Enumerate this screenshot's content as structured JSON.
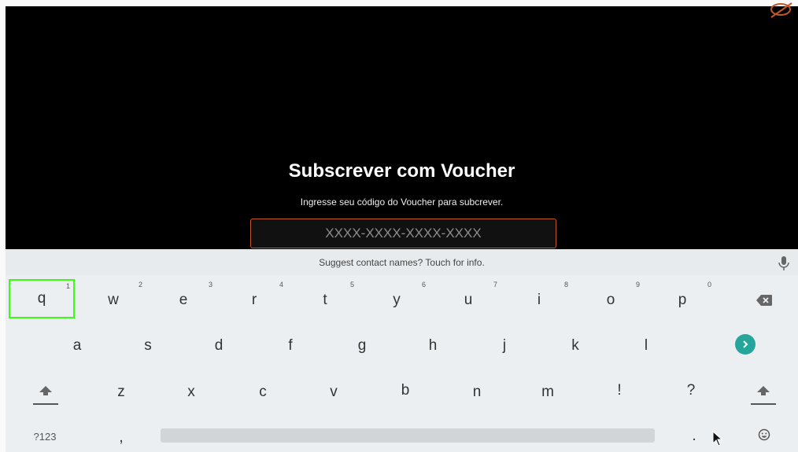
{
  "screen": {
    "title": "Subscrever com Voucher",
    "subtitle": "Ingresse seu código do Voucher para subcrever.",
    "voucher_placeholder": "XXXX-XXXX-XXXX-XXXX",
    "accent_color": "#c0582a"
  },
  "keyboard": {
    "suggest_text": "Suggest contact names? Touch for info.",
    "row1": [
      "q",
      "w",
      "e",
      "r",
      "t",
      "y",
      "u",
      "i",
      "o",
      "p"
    ],
    "row1_hints": [
      "1",
      "2",
      "3",
      "4",
      "5",
      "6",
      "7",
      "8",
      "9",
      "0"
    ],
    "row2": [
      "a",
      "s",
      "d",
      "f",
      "g",
      "h",
      "j",
      "k",
      "l"
    ],
    "row3": [
      "z",
      "x",
      "c",
      "v",
      "b",
      "n",
      "m",
      "!",
      "?"
    ],
    "row4": {
      "symbols": "?123",
      "comma": ",",
      "period": "."
    },
    "icons": [
      "mic-icon",
      "backspace-icon",
      "go-icon",
      "shift-icon",
      "emoji-icon",
      "cursor-icon",
      "no-signal-icon"
    ],
    "highlight_color": "#39ff14",
    "go_color": "#26a69a"
  }
}
